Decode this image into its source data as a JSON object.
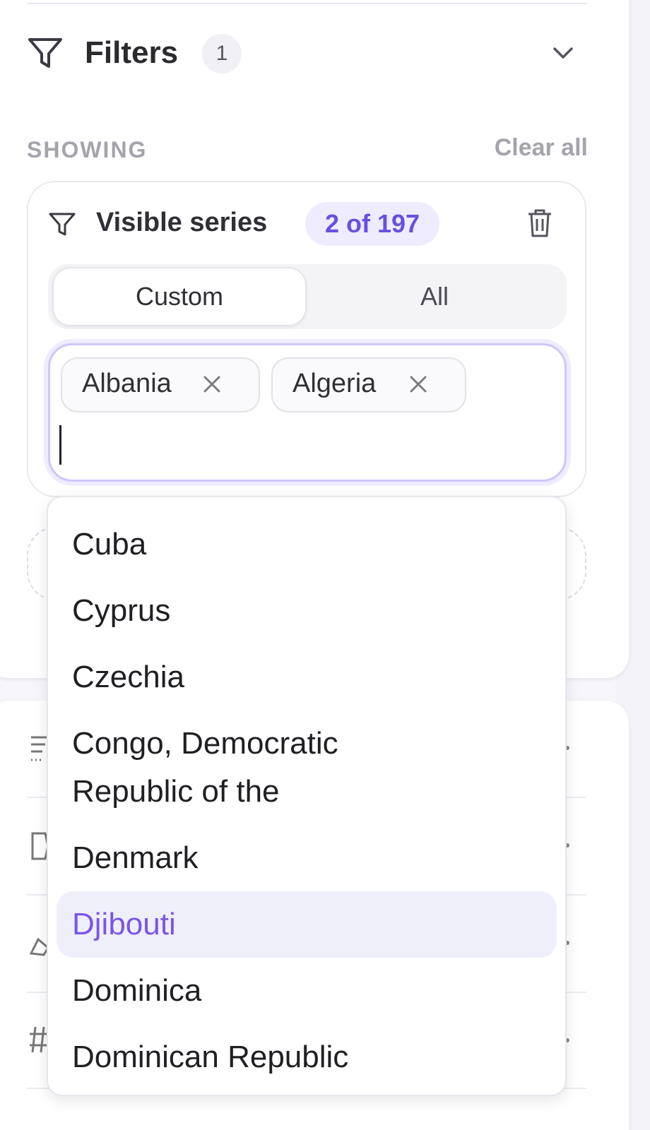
{
  "filters": {
    "title": "Filters",
    "count": "1",
    "showing_label": "SHOWING",
    "clear_all": "Clear all"
  },
  "series": {
    "title": "Visible series",
    "count": "2 of 197",
    "segments": [
      "Custom",
      "All"
    ],
    "selected_segment": "Custom",
    "chips": [
      "Albania",
      "Algeria"
    ],
    "input_value": ""
  },
  "dropdown": {
    "options": [
      "Cuba",
      "Cyprus",
      "Czechia",
      "Congo, Democratic",
      "Republic of the",
      "Denmark",
      "Djibouti",
      "Dominica",
      "Dominican Republic"
    ],
    "highlighted": "Djibouti"
  },
  "colors": {
    "accent": "#6b4fe0",
    "accent_bg": "#efecff",
    "highlight_bg": "#efeffa",
    "muted": "#a4a4ad"
  }
}
